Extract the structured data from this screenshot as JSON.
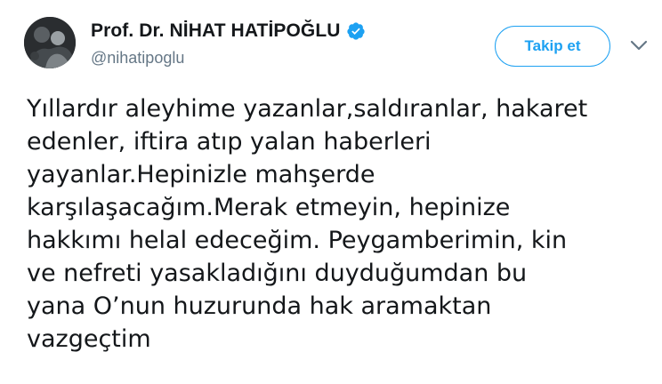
{
  "profile": {
    "display_name": "Prof. Dr. NİHAT HATİPOĞLU",
    "handle": "@nihatipoglu",
    "verified": true,
    "avatar_icon": "profile-photo",
    "verified_icon": "verified-badge-icon"
  },
  "actions": {
    "follow_label": "Takip et",
    "more_icon": "chevron-down-icon"
  },
  "tweet": {
    "lines": [
      "Yıllardır aleyhime yazanlar,saldıranlar, hakaret",
      "edenler, iftira atıp yalan haberleri",
      "yayanlar.Hepinizle mahşerde",
      "karşılaşacağım.Merak etmeyin, hepinize",
      "hakkımı helal edeceğim. Peygamberimin, kin",
      "ve nefreti yasakladığını duyduğumdan bu",
      "yana O’nun huzurunda hak aramaktan",
      "vazgeçtim"
    ]
  },
  "colors": {
    "accent": "#1da1f2",
    "text": "#14171a",
    "secondary_text": "#657786"
  }
}
